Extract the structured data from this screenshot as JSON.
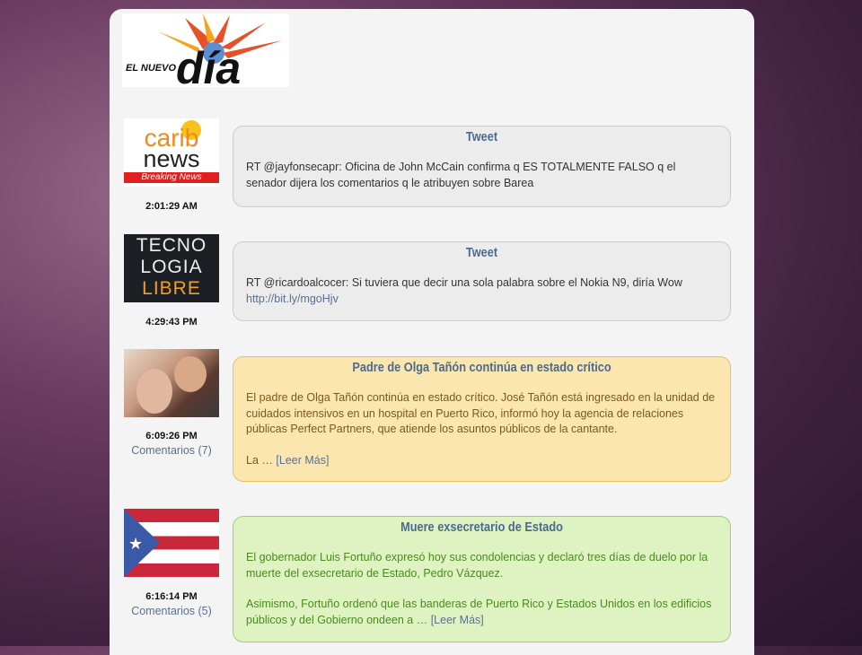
{
  "logo": {
    "text_small": "EL NUEVO",
    "text_big": "día"
  },
  "items": [
    {
      "thumb": "caribnews",
      "thumb_text": [
        "carib",
        "news",
        "Breaking News"
      ],
      "time": "2:01:29 AM",
      "title": "Tweet",
      "body": "RT @jayfonsecapr: Oficina de John McCain confirma q ES TOTALMENTE FALSO q el senador dijera los comentarios q le atribuyen sobre Barea",
      "color": "gray"
    },
    {
      "thumb": "tecnologialibre",
      "thumb_text": [
        "TECNO",
        "LOGIA",
        "LIBRE"
      ],
      "time": "4:29:43 PM",
      "title": "Tweet",
      "body": "RT @ricardoalcocer: Si tuviera que decir una sola palabra sobre el Nokia N9, diría Wow",
      "link": "http://bit.ly/mgoHjv",
      "color": "gray"
    },
    {
      "thumb": "photo",
      "time": "6:09:26 PM",
      "comments": "Comentarios (7)",
      "title": "Padre de Olga Tañón continúa en estado crítico",
      "body": "El padre de Olga Tañón continúa en estado crítico. José Tañón está ingresado en la unidad de cuidados intensivos en un hospital en Puerto Rico, informó hoy la agencia de relaciones públicas Perfect Partners, que atiende los asuntos públicos de la cantante.",
      "body2": "La …",
      "more": "[Leer Más]",
      "color": "#fbe6b0"
    },
    {
      "thumb": "puerto-rico-flag",
      "time": "6:16:14 PM",
      "comments": "Comentarios (5)",
      "title": "Muere exsecretario de Estado",
      "body": "El gobernador Luis Fortuño expresó hoy sus condolencias y  declaró tres días de duelo por la muerte del exsecretario de Estado, Pedro Vázquez.",
      "body2": "Asimismo, Fortuño ordenó que las banderas de Puerto Rico y Estados Unidos en los edificios públicos y del Gobierno ondeen a …",
      "more": "[Leer Más]",
      "color": "#dff3c2"
    }
  ]
}
